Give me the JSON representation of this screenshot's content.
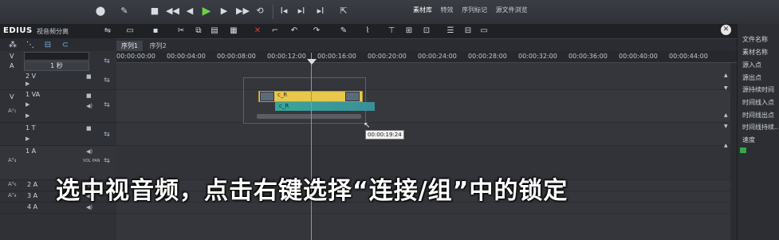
{
  "app": {
    "name": "EDIUS",
    "subtitle": "视音频分离"
  },
  "transport": {
    "buttons": [
      {
        "name": "marker-icon",
        "glyph": "⬤"
      },
      {
        "name": "pen-icon",
        "glyph": "✎"
      },
      {
        "name": "stop-icon",
        "glyph": "■"
      },
      {
        "name": "rewind-icon",
        "glyph": "◀◀"
      },
      {
        "name": "prev-frame-icon",
        "glyph": "◀"
      },
      {
        "name": "play-icon",
        "glyph": "▶"
      },
      {
        "name": "next-frame-icon",
        "glyph": "▶"
      },
      {
        "name": "fast-forward-icon",
        "glyph": "▶▶"
      },
      {
        "name": "loop-icon",
        "glyph": "⟲"
      },
      {
        "name": "set-in-icon",
        "glyph": "I◂"
      },
      {
        "name": "set-out-icon",
        "glyph": "▸I"
      },
      {
        "name": "insert-icon",
        "glyph": "▸I"
      },
      {
        "name": "export-icon",
        "glyph": "⇱"
      }
    ]
  },
  "palette_tabs": [
    "素材库",
    "特效",
    "序列标记",
    "源文件浏览"
  ],
  "sequence_tabs": [
    "序列1",
    "序列2"
  ],
  "ruler": {
    "ticks": [
      "00:00:00:00",
      "00:00:04:00",
      "00:00:08:00",
      "00:00:12:00",
      "00:00:16:00",
      "00:00:20:00",
      "00:00:24:00",
      "00:00:28:00",
      "00:00:32:00",
      "00:00:36:00",
      "00:00:40:00",
      "00:00:44:00"
    ]
  },
  "header": {
    "v_label": "V",
    "a_label": "A",
    "time_scale": "1 秒",
    "tracks": [
      {
        "label": "2 V"
      },
      {
        "label": "1 VA",
        "side": "V"
      },
      {
        "label": "1 T"
      },
      {
        "label": "1 A"
      },
      {
        "label": "2 A"
      },
      {
        "label": "3 A"
      },
      {
        "label": "4 A"
      }
    ],
    "vol_text": "VOL PAN"
  },
  "clips": {
    "video_label": "c_R",
    "audio_label": "c_R",
    "timecode_tip": "00:00:19:24"
  },
  "info_panel": {
    "items": [
      "文件名称",
      "素材名称",
      "源入点",
      "源出点",
      "源持续时间",
      "时间线入点",
      "时间线出点",
      "时间线持续...",
      "速度"
    ]
  },
  "caption": "选中视音频，点击右键选择“连接/组”中的锁定",
  "colors": {
    "video_clip": "#e8c74b",
    "audio_clip": "#3aa59a",
    "playhead": "#6aa0d6"
  }
}
